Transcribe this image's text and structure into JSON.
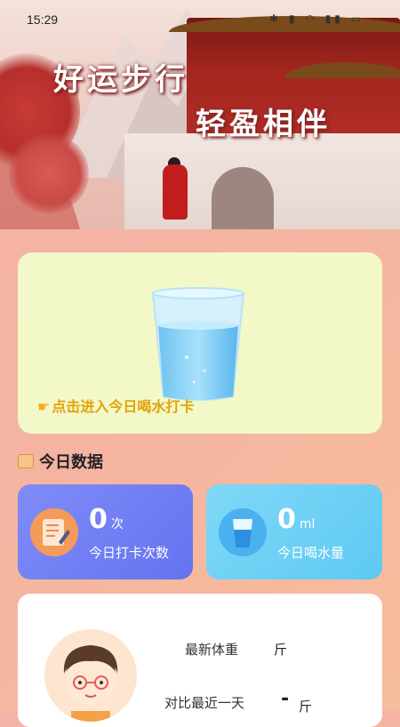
{
  "status": {
    "time": "15:29",
    "icons": "✱ ▮ ◠ ▮▮ ▭"
  },
  "banner": {
    "line1": "好运步行",
    "line2": "轻盈相伴"
  },
  "water_card": {
    "tip": "点击进入今日喝水打卡",
    "hand_icon": "pointing-hand-icon"
  },
  "section": {
    "title": "今日数据"
  },
  "stats": {
    "checkin": {
      "value": "0",
      "unit": "次",
      "label": "今日打卡次数"
    },
    "water": {
      "value": "0",
      "unit": "ml",
      "label": "今日喝水量"
    }
  },
  "profile": {
    "weight_label": "最新体重",
    "weight_unit": "斤",
    "compare_label": "对比最近一天",
    "compare_value": "-",
    "compare_unit": "斤"
  },
  "colors": {
    "accent_purple": "#6f7df4",
    "accent_blue": "#64cdf4",
    "tip_yellow": "#e2a30a",
    "card_cream": "#f2f8c7"
  }
}
